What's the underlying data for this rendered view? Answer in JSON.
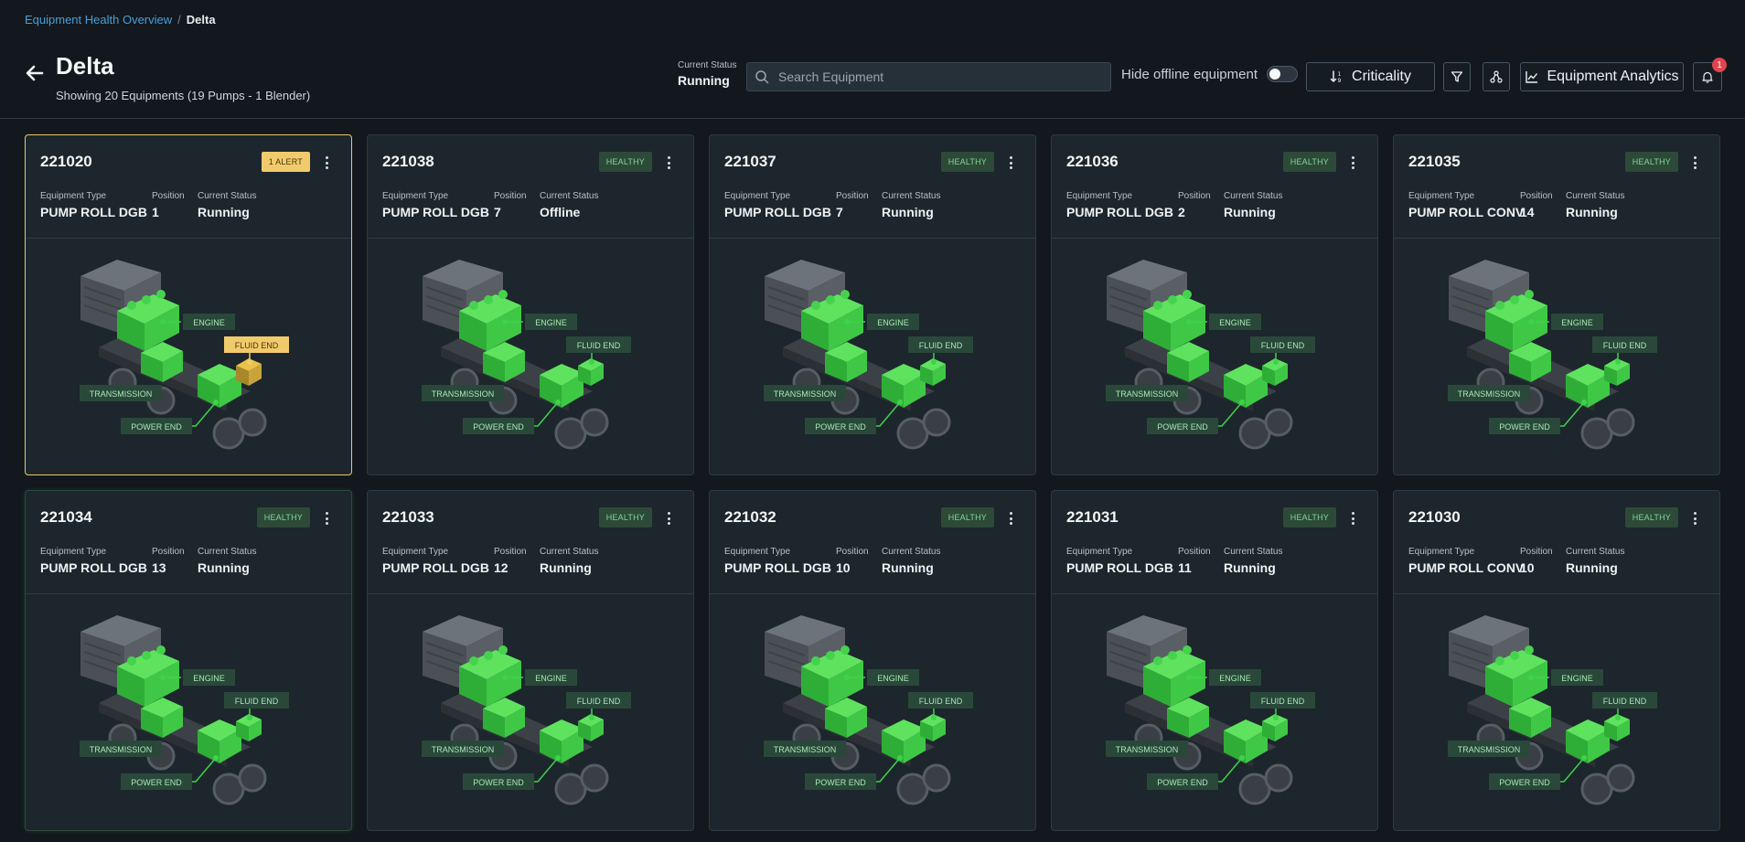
{
  "breadcrumb": {
    "parent": "Equipment Health Overview",
    "separator": "/",
    "current": "Delta"
  },
  "header": {
    "title": "Delta",
    "subtitle": "Showing 20 Equipments (19 Pumps - 1 Blender)",
    "current_status_label": "Current Status",
    "current_status_value": "Running",
    "search_placeholder": "Search Equipment",
    "hide_offline_label": "Hide offline equipment",
    "hide_offline_on": false,
    "criticality_label": "Criticality",
    "analytics_label": "Equipment Analytics",
    "notification_count": "1"
  },
  "field_labels": {
    "type": "Equipment Type",
    "position": "Position",
    "status": "Current Status"
  },
  "component_labels": {
    "engine": "ENGINE",
    "fluid_end": "FLUID END",
    "transmission": "TRANSMISSION",
    "power_end": "POWER END"
  },
  "colors": {
    "accent_link": "#4a9fd8",
    "healthy_green": "#3fd24a",
    "alert_yellow": "#f1cb6b",
    "notification_red": "#e0444e"
  },
  "cards": [
    {
      "id": "221020",
      "badge": "1 ALERT",
      "badge_kind": "alert",
      "type": "PUMP ROLL DGB",
      "position": "1",
      "status": "Running"
    },
    {
      "id": "221038",
      "badge": "HEALTHY",
      "badge_kind": "healthy",
      "type": "PUMP ROLL DGB",
      "position": "7",
      "status": "Offline"
    },
    {
      "id": "221037",
      "badge": "HEALTHY",
      "badge_kind": "healthy",
      "type": "PUMP ROLL DGB",
      "position": "7",
      "status": "Running"
    },
    {
      "id": "221036",
      "badge": "HEALTHY",
      "badge_kind": "healthy",
      "type": "PUMP ROLL DGB",
      "position": "2",
      "status": "Running"
    },
    {
      "id": "221035",
      "badge": "HEALTHY",
      "badge_kind": "healthy",
      "type": "PUMP ROLL CONV",
      "position": "14",
      "status": "Running"
    },
    {
      "id": "221034",
      "badge": "HEALTHY",
      "badge_kind": "healthy",
      "type": "PUMP ROLL DGB",
      "position": "13",
      "status": "Running"
    },
    {
      "id": "221033",
      "badge": "HEALTHY",
      "badge_kind": "healthy",
      "type": "PUMP ROLL DGB",
      "position": "12",
      "status": "Running"
    },
    {
      "id": "221032",
      "badge": "HEALTHY",
      "badge_kind": "healthy",
      "type": "PUMP ROLL DGB",
      "position": "10",
      "status": "Running"
    },
    {
      "id": "221031",
      "badge": "HEALTHY",
      "badge_kind": "healthy",
      "type": "PUMP ROLL DGB",
      "position": "11",
      "status": "Running"
    },
    {
      "id": "221030",
      "badge": "HEALTHY",
      "badge_kind": "healthy",
      "type": "PUMP ROLL CONV",
      "position": "10",
      "status": "Running"
    }
  ]
}
